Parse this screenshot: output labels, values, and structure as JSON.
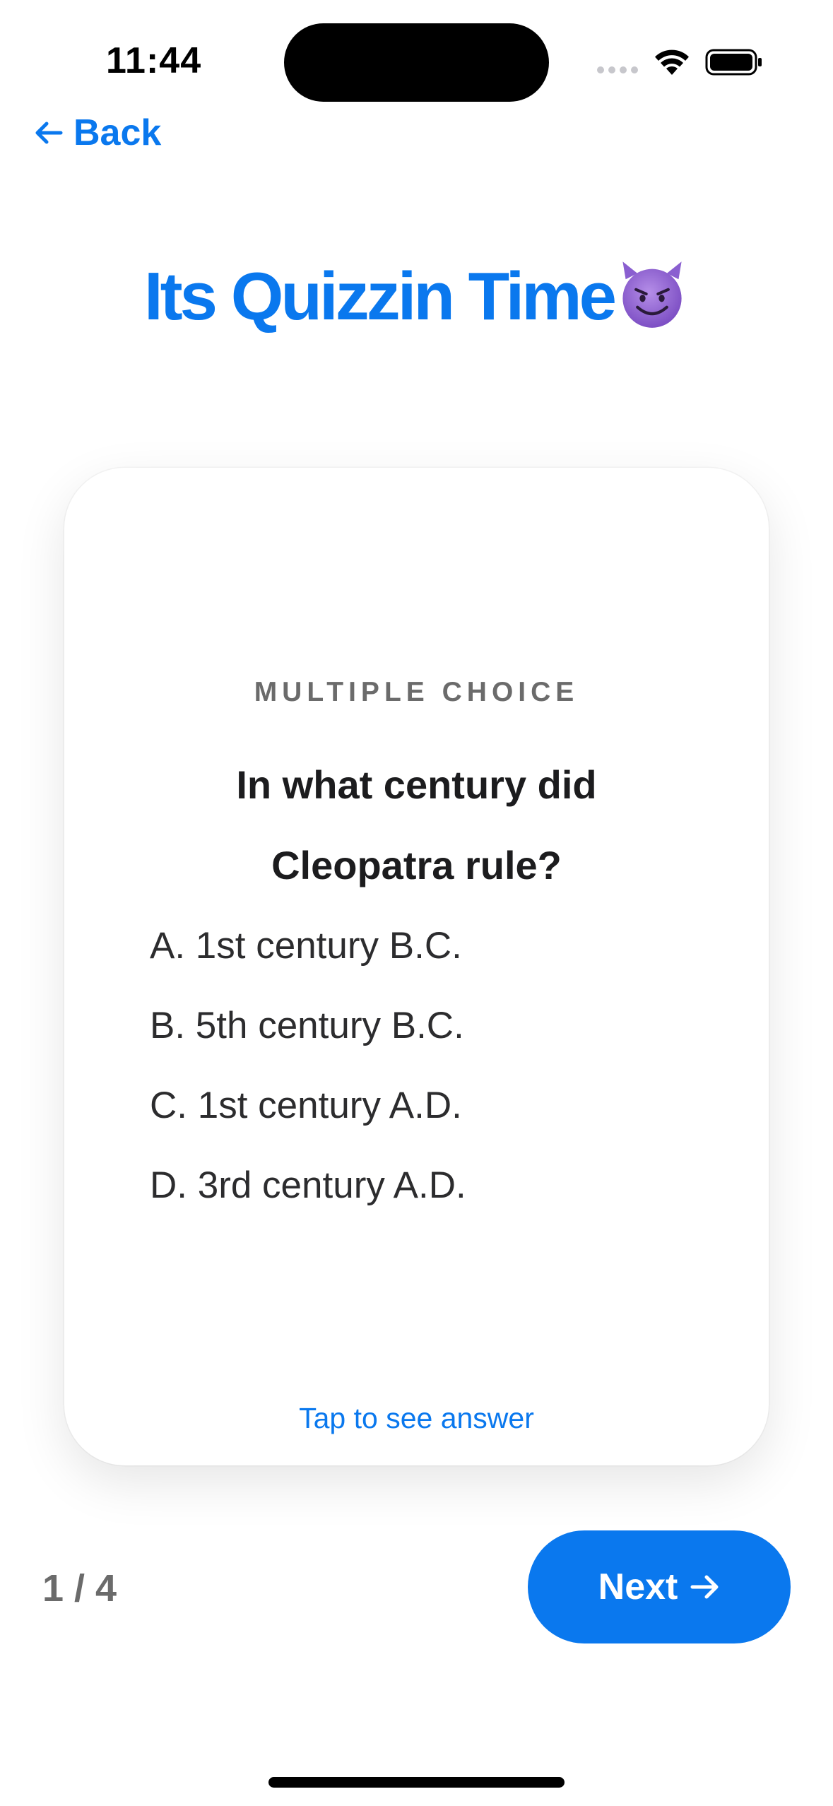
{
  "status_bar": {
    "time": "11:44",
    "icons": [
      "cellular-signal-icon",
      "wifi-icon",
      "battery-icon"
    ]
  },
  "nav": {
    "back_label": "Back",
    "back_icon": "arrow-left-icon"
  },
  "header": {
    "title": "Its Quizzin Time",
    "emoji_icon": "smiling-devil-icon"
  },
  "card": {
    "question_type": "MULTIPLE CHOICE",
    "question": "In what century did Cleopatra rule?",
    "options": [
      "A. 1st century B.C.",
      "B. 5th century B.C.",
      "C. 1st century A.D.",
      "D. 3rd century A.D."
    ],
    "hint": "Tap to see answer"
  },
  "footer": {
    "progress": "1 / 4",
    "next_label": "Next",
    "next_icon": "arrow-right-icon"
  },
  "colors": {
    "accent": "#0a78ee",
    "text_primary": "#1c1c1e",
    "text_secondary": "#6b6b6b",
    "background": "#ffffff"
  }
}
